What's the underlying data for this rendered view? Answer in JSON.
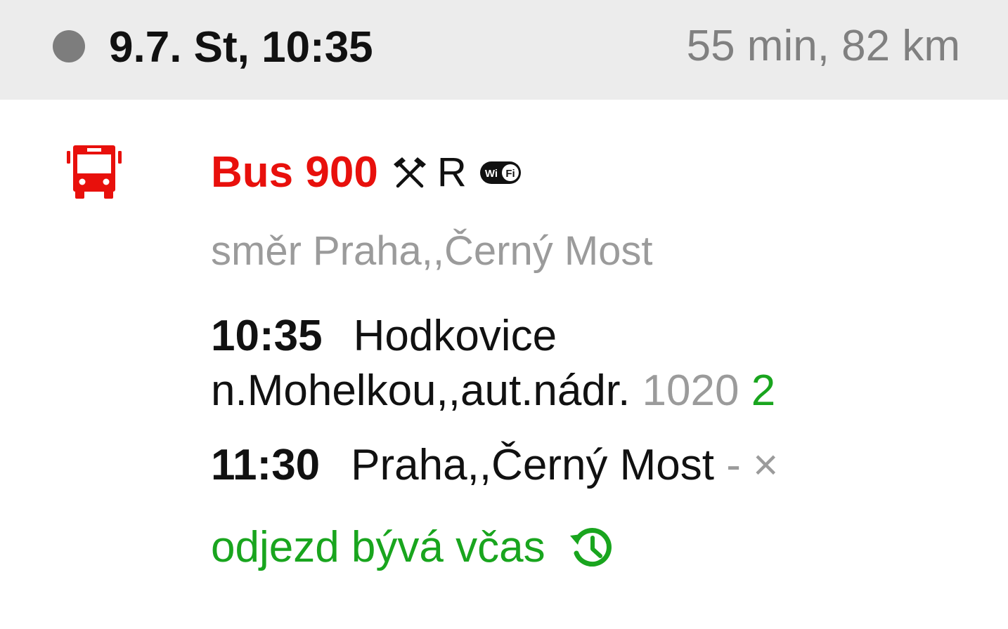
{
  "header": {
    "date_time": "9.7. St, 10:35",
    "summary": "55 min, 82 km"
  },
  "connection": {
    "transport_icon": "bus-icon",
    "line_name": "Bus 900",
    "feature_icons": [
      "tools-icon",
      "wifi-icon"
    ],
    "reservation_mark": "R",
    "direction": "směr Praha,,Černý Most",
    "departure": {
      "time": "10:35",
      "stop": "Hodkovice n.Mohelkou,,aut.nádr.",
      "platform": "1020",
      "track": "2"
    },
    "arrival": {
      "time": "11:30",
      "stop": "Praha,,Černý Most",
      "extra": "- ×"
    },
    "punctuality": "odjezd bývá včas",
    "punctuality_icon": "history-icon"
  },
  "colors": {
    "accent_red": "#e8100c",
    "green": "#19a51e",
    "muted_gray": "#9b9b9b",
    "header_bg": "#ececec"
  }
}
